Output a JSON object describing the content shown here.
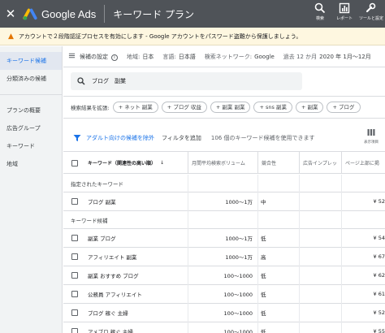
{
  "topbar": {
    "close": "✕",
    "brand": "Google Ads",
    "page_title": "キーワード プラン",
    "tools": [
      {
        "icon": "search-icon",
        "label": "検索"
      },
      {
        "icon": "reports-icon",
        "label": "レポート"
      },
      {
        "icon": "wrench-icon",
        "label": "ツールと設定"
      }
    ]
  },
  "alert": {
    "icon": "▲",
    "text": "アカウントで２段階認証プロセスを有効にします - Google アカウントをパスワード盗難から保護しましょう。"
  },
  "sidebar": {
    "items": [
      {
        "label": "キーワード候補",
        "active": true
      },
      {
        "label": "分類済みの候補",
        "active": false
      },
      {
        "label": "プランの概要",
        "active": false
      },
      {
        "label": "広告グループ",
        "active": false
      },
      {
        "label": "キーワード",
        "active": false
      },
      {
        "label": "地域",
        "active": false
      }
    ]
  },
  "settings_bar": {
    "title": "候補の設定",
    "location_label": "地域:",
    "location_value": "日本",
    "language_label": "言語:",
    "language_value": "日本語",
    "network_label": "検索ネットワーク:",
    "network_value": "Google",
    "period_label": "過去 12 か月",
    "period_value": "2020 年 1月～12月"
  },
  "search": {
    "value": "ブログ　副業"
  },
  "broaden": {
    "label": "検索結果を拡張:",
    "chips": [
      "ネット 副業",
      "ブログ 収益",
      "副業 副業",
      "sns 副業",
      "副業",
      "ブログ"
    ]
  },
  "filterbar": {
    "exclude_adult": "アダルト向けの候補を除外",
    "add_filter": "フィルタを追加",
    "count_text": "106 個のキーワード候補を使用できます",
    "columns_label": "表示項目"
  },
  "table": {
    "headers": {
      "keyword": "キーワード（関連性の高い順）",
      "sort_arrow": "↓",
      "volume": "月間平均検索ボリューム",
      "competition": "競合性",
      "impression_share": "広告インプレッ",
      "top_bid": "ページ上部に掲"
    },
    "provided_section": "指定されたキーワード",
    "provided_rows": [
      {
        "keyword": "ブログ 副業",
        "volume": "1000～1万",
        "competition": "中",
        "bid": "¥ 52"
      }
    ],
    "ideas_section": "キーワード候補",
    "idea_rows": [
      {
        "keyword": "副業 ブログ",
        "volume": "1000～1万",
        "competition": "低",
        "bid": "¥ 54"
      },
      {
        "keyword": "アフィリエイト 副業",
        "volume": "1000～1万",
        "competition": "高",
        "bid": "¥ 67"
      },
      {
        "keyword": "副業 おすすめ ブログ",
        "volume": "100～1000",
        "competition": "低",
        "bid": "¥ 62"
      },
      {
        "keyword": "公務員 アフィリエイト",
        "volume": "100～1000",
        "competition": "低",
        "bid": "¥ 61"
      },
      {
        "keyword": "ブログ 稼ぐ 主婦",
        "volume": "100～1000",
        "competition": "低",
        "bid": "¥ 52"
      },
      {
        "keyword": "アメブロ 稼ぐ 主婦",
        "volume": "100～1000",
        "competition": "低",
        "bid": "¥ 55"
      }
    ]
  },
  "colors": {
    "topbar": "#4f5358",
    "accent": "#1a73e8",
    "alert_bg": "#fef7e0",
    "sidebar_bg": "#f1f3f4"
  }
}
